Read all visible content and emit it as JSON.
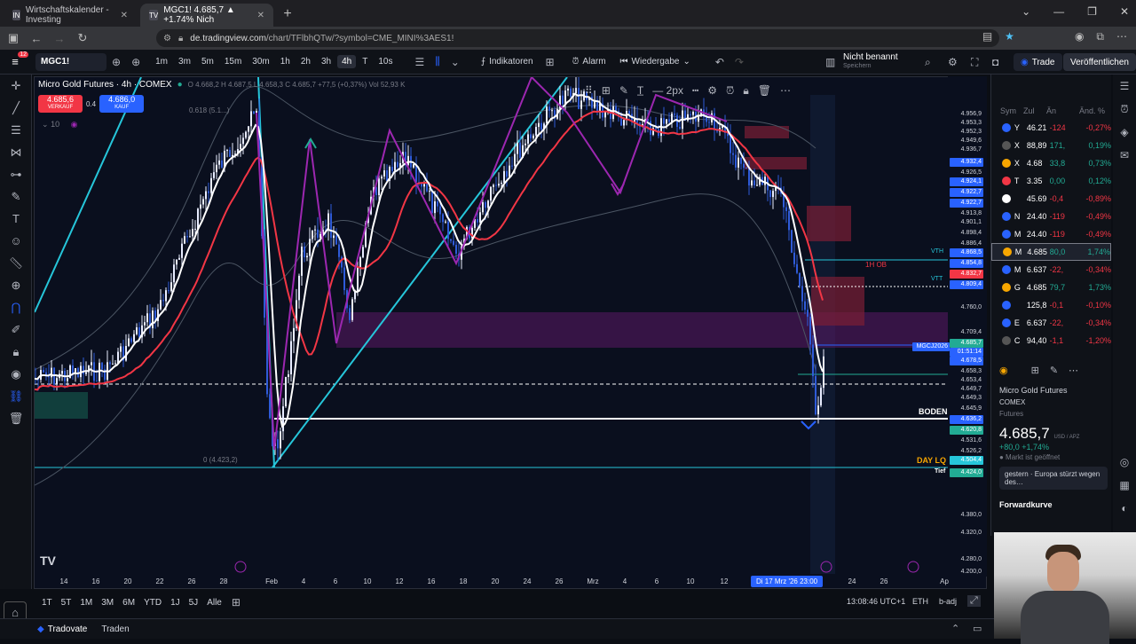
{
  "browser": {
    "tabs": [
      {
        "icon": "IN",
        "title": "Wirtschaftskalender - Investing"
      },
      {
        "icon": "TV",
        "title": "MGC1! 4.685,7 ▲ +1.74% Nich"
      }
    ],
    "url_domain": "de.tradingview.com",
    "url_path": "/chart/TFlbhQTw/?symbol=CME_MINI%3AES1!"
  },
  "toolbar": {
    "notif_count": "12",
    "symbol": "MGC1!",
    "timeframes": [
      "1m",
      "3m",
      "5m",
      "15m",
      "30m",
      "1h",
      "2h",
      "3h",
      "4h",
      "T",
      "10s"
    ],
    "active_timeframe": "4h",
    "indicators_label": "Indikatoren",
    "alarm_label": "Alarm",
    "replay_label": "Wiedergabe",
    "layout_name": "Nicht benannt",
    "layout_sub": "Speichern",
    "trade_label": "Trade",
    "publish_label": "Veröffentlichen"
  },
  "chart": {
    "title": "Micro Gold Futures · 4h · COMEX",
    "ohlc": "O 4.668,2 H 4.687,5 L 4.658,3 C 4.685,7 +77,5 (+0,37%) Vol 52,93 K",
    "sell_price": "4.685,6",
    "sell_label": "VERKAUF",
    "buy_price": "4.686,0",
    "buy_label": "KAUF",
    "spread": "0.4",
    "indicator_count": "10",
    "fib_label_top": "0.618 (5.1...)",
    "fib_label_bottom": "0 (4.423,2)",
    "labels": {
      "ob": "1H OB",
      "vth": "VTH",
      "vtt": "VTT",
      "boden": "BODEN",
      "day_lq": "DAY LQ",
      "tief": "Tief",
      "contract": "MGCJ2026",
      "countdown": "01:51:14"
    },
    "price_labels": [
      "4.956,9",
      "4.953,3",
      "4.952,3",
      "4.949,6",
      "4.936,7",
      "4.932,4",
      "4.926,5",
      "4.924,1",
      "4.922,7",
      "4.922,7",
      "4.913,8",
      "4.901,1",
      "4.898,4",
      "4.886,4",
      "4.868,5",
      "4.854,8",
      "4.832,7",
      "4.809,4",
      "4.760,0",
      "4.709,4",
      "4.685,7",
      "4.678,5",
      "4.658,3",
      "4.653,4",
      "4.649,7",
      "4.649,3",
      "4.645,9",
      "4.636,2",
      "4.620,8",
      "4.531,6",
      "4.526,2",
      "4.504,4",
      "4.424,0",
      "4.380,0",
      "4.320,0",
      "4.280,0",
      "4.200,0"
    ],
    "time_labels": [
      "14",
      "16",
      "20",
      "22",
      "26",
      "28",
      "Feb",
      "4",
      "6",
      "10",
      "12",
      "16",
      "18",
      "20",
      "24",
      "26",
      "Mrz",
      "4",
      "6",
      "10",
      "12",
      "Di 17 Mrz '26  23:00",
      "24",
      "26",
      "Ap"
    ],
    "price_colors": {
      "up": "#22ab94",
      "down": "#f23645",
      "accent": "#2962ff",
      "purple": "#9c27b0"
    }
  },
  "bottom": {
    "ranges": [
      "1T",
      "5T",
      "1M",
      "3M",
      "6M",
      "YTD",
      "1J",
      "5J",
      "Alle"
    ],
    "clock": "13:08:46 UTC+1",
    "session": "ETH",
    "adj": "b-adj"
  },
  "broker": {
    "tradovate": "Tradovate",
    "traden": "Traden"
  },
  "watchlist": {
    "headers": [
      "Sym",
      "Zul",
      "Än",
      "Änd. %"
    ],
    "rows": [
      {
        "sym": "Y",
        "last": "46.21",
        "chg": "-124",
        "pct": "-0,27%",
        "color": "#2962ff",
        "dir": "neg"
      },
      {
        "sym": "X",
        "last": "88,89",
        "chg": "171,",
        "pct": "0,19%",
        "color": "#555",
        "dir": "pos"
      },
      {
        "sym": "X",
        "last": "4.68",
        "chg": "33,8",
        "pct": "0,73%",
        "color": "#f7a600",
        "dir": "pos"
      },
      {
        "sym": "T",
        "last": "3.35",
        "chg": "0,00",
        "pct": "0,12%",
        "color": "#f23645",
        "dir": "pos"
      },
      {
        "sym": "",
        "last": "45.69",
        "chg": "-0,4",
        "pct": "-0,89%",
        "color": "#fff",
        "dir": "neg"
      },
      {
        "sym": "N",
        "last": "24.40",
        "chg": "-119",
        "pct": "-0,49%",
        "color": "#2962ff",
        "dir": "neg"
      },
      {
        "sym": "M",
        "last": "24.40",
        "chg": "-119",
        "pct": "-0,49%",
        "color": "#2962ff",
        "dir": "neg"
      },
      {
        "sym": "M",
        "last": "4.685",
        "chg": "80,0",
        "pct": "1,74%",
        "color": "#f7a600",
        "dir": "pos",
        "selected": true
      },
      {
        "sym": "M",
        "last": "6.637",
        "chg": "-22,",
        "pct": "-0,34%",
        "color": "#2962ff",
        "dir": "neg"
      },
      {
        "sym": "G",
        "last": "4.685",
        "chg": "79,7",
        "pct": "1,73%",
        "color": "#f7a600",
        "dir": "pos"
      },
      {
        "sym": "",
        "last": "125,8",
        "chg": "-0,1",
        "pct": "-0,10%",
        "color": "#2962ff",
        "dir": "neg"
      },
      {
        "sym": "E",
        "last": "6.637",
        "chg": "-22,",
        "pct": "-0,34%",
        "color": "#2962ff",
        "dir": "neg"
      },
      {
        "sym": "C",
        "last": "94,40",
        "chg": "-1,1",
        "pct": "-1,20%",
        "color": "#555",
        "dir": "neg"
      }
    ]
  },
  "detail": {
    "name": "Micro Gold Futures",
    "exchange": "COMEX",
    "type": "Futures",
    "price": "4.685,7",
    "currency": "USD / APZ",
    "change": "+80,0 +1,74%",
    "market": "● Markt ist geöffnet",
    "news": "gestern · Europa stürzt wegen des…",
    "forward": "Forwardkurve"
  }
}
